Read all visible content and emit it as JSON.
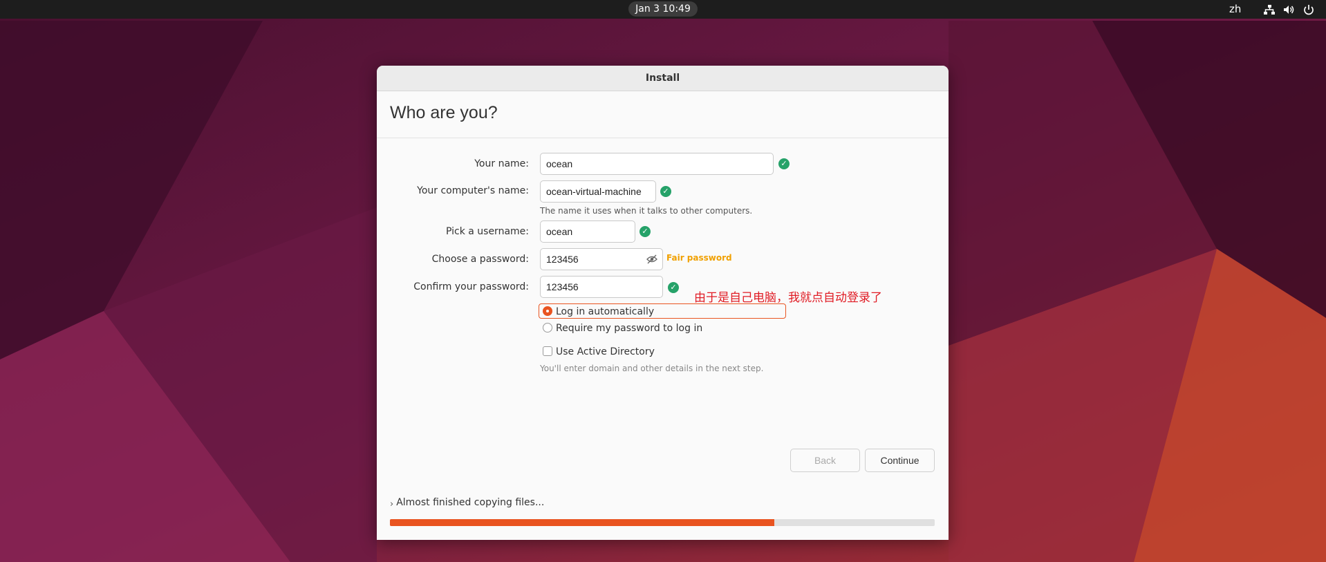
{
  "topbar": {
    "datetime": "Jan 3  10:49",
    "language": "zh"
  },
  "window": {
    "title": "Install",
    "heading": "Who are you?"
  },
  "form": {
    "your_name": {
      "label": "Your name:",
      "value": "ocean"
    },
    "computer_name": {
      "label": "Your computer's name:",
      "value": "ocean-virtual-machine",
      "hint": "The name it uses when it talks to other computers."
    },
    "username": {
      "label": "Pick a username:",
      "value": "ocean"
    },
    "password": {
      "label": "Choose a password:",
      "value": "123456",
      "strength": "Fair password"
    },
    "confirm_password": {
      "label": "Confirm your password:",
      "value": "123456"
    },
    "login_options": [
      {
        "label": "Log in automatically",
        "selected": true
      },
      {
        "label": "Require my password to log in",
        "selected": false
      }
    ],
    "active_directory": {
      "label": "Use Active Directory",
      "checked": false,
      "hint": "You'll enter domain and other details in the next step."
    }
  },
  "annotation": "由于是自己电脑，我就点自动登录了",
  "buttons": {
    "back": "Back",
    "continue": "Continue"
  },
  "status": {
    "text": "Almost finished copying files...",
    "progress_fraction": 0.705
  },
  "colors": {
    "accent": "#e95420",
    "valid": "#26a269",
    "strength_fair": "#f0a000",
    "annotation": "#e01b24"
  },
  "icons": {
    "network": "network-wired-icon",
    "volume": "speaker-icon",
    "power": "power-icon",
    "valid": "checkmark-circle-icon",
    "show_password": "eye-slash-icon",
    "expander": "chevron-right-icon"
  }
}
